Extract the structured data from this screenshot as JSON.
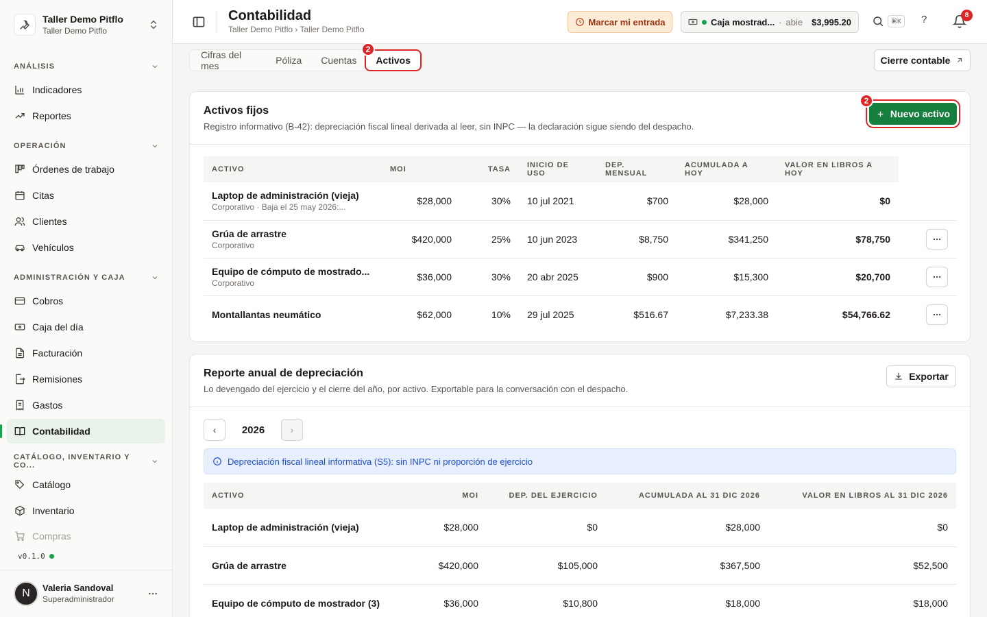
{
  "workspace": {
    "name": "Taller Demo Pitflo",
    "sub": "Taller Demo Pitflo"
  },
  "sidebar": {
    "sections": [
      {
        "label": "ANÁLISIS"
      },
      {
        "label": "OPERACIÓN"
      },
      {
        "label": "ADMINISTRACIÓN Y CAJA"
      },
      {
        "label": "CATÁLOGO, INVENTARIO Y CO..."
      }
    ],
    "items": [
      {
        "label": "Indicadores",
        "icon": "bar-chart-icon"
      },
      {
        "label": "Reportes",
        "icon": "trending-up-icon"
      },
      {
        "label": "Órdenes de trabajo",
        "icon": "kanban-icon"
      },
      {
        "label": "Citas",
        "icon": "calendar-icon"
      },
      {
        "label": "Clientes",
        "icon": "users-icon"
      },
      {
        "label": "Vehículos",
        "icon": "car-icon"
      },
      {
        "label": "Cobros",
        "icon": "credit-card-icon"
      },
      {
        "label": "Caja del día",
        "icon": "banknote-icon"
      },
      {
        "label": "Facturación",
        "icon": "file-icon"
      },
      {
        "label": "Remisiones",
        "icon": "file-export-icon"
      },
      {
        "label": "Gastos",
        "icon": "receipt-icon"
      },
      {
        "label": "Contabilidad",
        "icon": "book-icon"
      },
      {
        "label": "Catálogo",
        "icon": "tag-icon"
      },
      {
        "label": "Inventario",
        "icon": "package-icon"
      },
      {
        "label": "Compras",
        "icon": "cart-icon"
      }
    ],
    "version": "v0.1.0",
    "user": {
      "initial": "N",
      "name": "Valeria Sandoval",
      "role": "Superadministrador"
    }
  },
  "header": {
    "title": "Contabilidad",
    "breadcrumb": "Taller Demo Pitflo › Taller Demo Pitflo",
    "entry_button": "Marcar mi entrada",
    "caja": {
      "name": "Caja mostrad...",
      "sep": "·",
      "state": "abie",
      "amount": "$3,995.20"
    },
    "shortcut": "⌘K",
    "help": "?",
    "notifications": "8"
  },
  "tabs": [
    {
      "label": "Cifras del mes"
    },
    {
      "label": "Póliza"
    },
    {
      "label": "Cuentas"
    },
    {
      "label": "Activos"
    }
  ],
  "step_badge": "2",
  "cierre_button": "Cierre contable",
  "activos": {
    "title": "Activos fijos",
    "description": "Registro informativo (B-42): depreciación fiscal lineal derivada al leer, sin INPC — la declaración sigue siendo del despacho.",
    "new_button": "Nuevo activo",
    "headers": [
      "ACTIVO",
      "MOI",
      "TASA",
      "INICIO DE USO",
      "DEP. MENSUAL",
      "ACUMULADA A HOY",
      "VALOR EN LIBROS A HOY"
    ],
    "rows": [
      {
        "name": "Laptop de administración (vieja)",
        "sub": "Corporativo · Baja el 25 may 2026:...",
        "moi": "$28,000",
        "tasa": "30%",
        "inicio": "10 jul 2021",
        "dep": "$700",
        "acum": "$28,000",
        "valor": "$0"
      },
      {
        "name": "Grúa de arrastre",
        "sub": "Corporativo",
        "moi": "$420,000",
        "tasa": "25%",
        "inicio": "10 jun 2023",
        "dep": "$8,750",
        "acum": "$341,250",
        "valor": "$78,750"
      },
      {
        "name": "Equipo de cómputo de mostrado...",
        "sub": "Corporativo",
        "moi": "$36,000",
        "tasa": "30%",
        "inicio": "20 abr 2025",
        "dep": "$900",
        "acum": "$15,300",
        "valor": "$20,700"
      },
      {
        "name": "Montallantas neumático",
        "sub": "",
        "moi": "$62,000",
        "tasa": "10%",
        "inicio": "29 jul 2025",
        "dep": "$516.67",
        "acum": "$7,233.38",
        "valor": "$54,766.62"
      }
    ]
  },
  "reporte": {
    "title": "Reporte anual de depreciación",
    "description": "Lo devengado del ejercicio y el cierre del año, por activo. Exportable para la conversación con el despacho.",
    "export_button": "Exportar",
    "year": "2026",
    "prev": "‹",
    "next": "›",
    "info": "Depreciación fiscal lineal informativa (S5): sin INPC ni proporción de ejercicio",
    "headers": [
      "ACTIVO",
      "MOI",
      "DEP. DEL EJERCICIO",
      "ACUMULADA AL 31 DIC 2026",
      "VALOR EN LIBROS AL 31 DIC 2026"
    ],
    "rows": [
      {
        "name": "Laptop de administración (vieja)",
        "moi": "$28,000",
        "dep": "$0",
        "acum": "$28,000",
        "valor": "$0"
      },
      {
        "name": "Grúa de arrastre",
        "moi": "$420,000",
        "dep": "$105,000",
        "acum": "$367,500",
        "valor": "$52,500"
      },
      {
        "name": "Equipo de cómputo de mostrador (3)",
        "moi": "$36,000",
        "dep": "$10,800",
        "acum": "$18,000",
        "valor": "$18,000"
      }
    ]
  }
}
